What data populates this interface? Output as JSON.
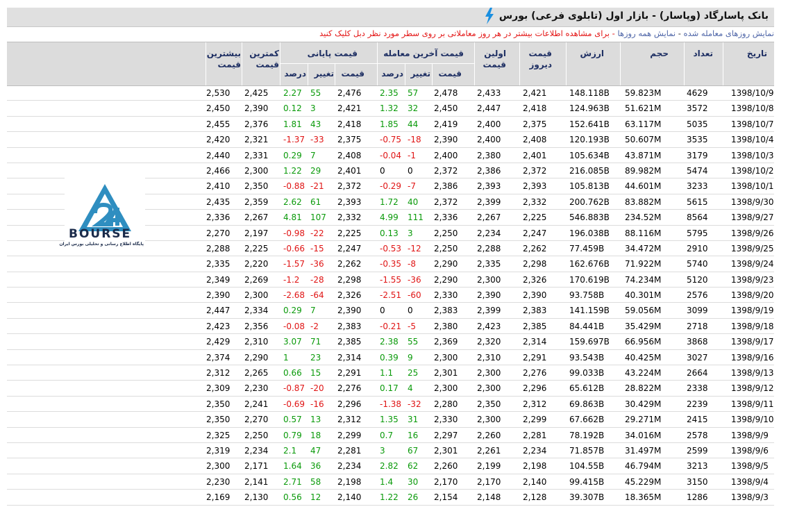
{
  "window": {
    "title": "بانک پاسارگاد (وپاسار) - بازار اول (تابلوی فرعی) بورس"
  },
  "infobar": {
    "link_traded": "نمایش روزهای معامله شده",
    "link_all": "نمایش همه روزها",
    "sep": "-",
    "message": "- برای مشاهده اطلاعات بیشتر در هر روز معاملاتی بر روی سطر مورد نظر دبل کلیک کنید"
  },
  "columns": {
    "date": "تاریخ",
    "count": "تعداد",
    "volume": "حجم",
    "value": "ارزش",
    "yesterday": "قیمت دیروز",
    "first": "اولین قیمت",
    "last_group": "قیمت آخرین معامله",
    "close_group": "قیمت پایانی",
    "price": "قیمت",
    "change": "تغییر",
    "percent": "درصد",
    "low": "کمترین قیمت",
    "high": "بیشترین قیمت"
  },
  "logo": {
    "text": "BOURSE",
    "caption": "پایگاه اطلاع رسانی و تحلیلی بورس ایران"
  },
  "rows": [
    {
      "high": "2,530",
      "low": "2,425",
      "close_pct": "2.27",
      "close_chg": "55",
      "close": "2,476",
      "last_pct": "2.35",
      "last_chg": "57",
      "last": "2,478",
      "first": "2,433",
      "yesterday": "2,421",
      "value": "148.118B",
      "volume": "59.823M",
      "count": "4629",
      "date": "1398/10/9"
    },
    {
      "high": "2,450",
      "low": "2,390",
      "close_pct": "0.12",
      "close_chg": "3",
      "close": "2,421",
      "last_pct": "1.32",
      "last_chg": "32",
      "last": "2,450",
      "first": "2,447",
      "yesterday": "2,418",
      "value": "124.963B",
      "volume": "51.621M",
      "count": "3572",
      "date": "1398/10/8"
    },
    {
      "high": "2,455",
      "low": "2,376",
      "close_pct": "1.81",
      "close_chg": "43",
      "close": "2,418",
      "last_pct": "1.85",
      "last_chg": "44",
      "last": "2,419",
      "first": "2,400",
      "yesterday": "2,375",
      "value": "152.641B",
      "volume": "63.117M",
      "count": "5035",
      "date": "1398/10/7"
    },
    {
      "high": "2,420",
      "low": "2,321",
      "close_pct": "-1.37",
      "close_chg": "-33",
      "close": "2,375",
      "last_pct": "-0.75",
      "last_chg": "-18",
      "last": "2,390",
      "first": "2,400",
      "yesterday": "2,408",
      "value": "120.193B",
      "volume": "50.607M",
      "count": "3535",
      "date": "1398/10/4"
    },
    {
      "high": "2,440",
      "low": "2,331",
      "close_pct": "0.29",
      "close_chg": "7",
      "close": "2,408",
      "last_pct": "-0.04",
      "last_chg": "-1",
      "last": "2,400",
      "first": "2,380",
      "yesterday": "2,401",
      "value": "105.634B",
      "volume": "43.871M",
      "count": "3179",
      "date": "1398/10/3"
    },
    {
      "high": "2,466",
      "low": "2,300",
      "close_pct": "1.22",
      "close_chg": "29",
      "close": "2,401",
      "last_pct": "0",
      "last_chg": "0",
      "last": "2,372",
      "first": "2,386",
      "yesterday": "2,372",
      "value": "216.085B",
      "volume": "89.982M",
      "count": "5474",
      "date": "1398/10/2"
    },
    {
      "high": "2,410",
      "low": "2,350",
      "close_pct": "-0.88",
      "close_chg": "-21",
      "close": "2,372",
      "last_pct": "-0.29",
      "last_chg": "-7",
      "last": "2,386",
      "first": "2,393",
      "yesterday": "2,393",
      "value": "105.813B",
      "volume": "44.601M",
      "count": "3233",
      "date": "1398/10/1"
    },
    {
      "high": "2,435",
      "low": "2,359",
      "close_pct": "2.62",
      "close_chg": "61",
      "close": "2,393",
      "last_pct": "1.72",
      "last_chg": "40",
      "last": "2,372",
      "first": "2,399",
      "yesterday": "2,332",
      "value": "200.762B",
      "volume": "83.882M",
      "count": "5615",
      "date": "1398/9/30"
    },
    {
      "high": "2,336",
      "low": "2,267",
      "close_pct": "4.81",
      "close_chg": "107",
      "close": "2,332",
      "last_pct": "4.99",
      "last_chg": "111",
      "last": "2,336",
      "first": "2,267",
      "yesterday": "2,225",
      "value": "546.883B",
      "volume": "234.52M",
      "count": "8564",
      "date": "1398/9/27"
    },
    {
      "high": "2,270",
      "low": "2,197",
      "close_pct": "-0.98",
      "close_chg": "-22",
      "close": "2,225",
      "last_pct": "0.13",
      "last_chg": "3",
      "last": "2,250",
      "first": "2,234",
      "yesterday": "2,247",
      "value": "196.038B",
      "volume": "88.116M",
      "count": "5795",
      "date": "1398/9/26"
    },
    {
      "high": "2,288",
      "low": "2,225",
      "close_pct": "-0.66",
      "close_chg": "-15",
      "close": "2,247",
      "last_pct": "-0.53",
      "last_chg": "-12",
      "last": "2,250",
      "first": "2,288",
      "yesterday": "2,262",
      "value": "77.459B",
      "volume": "34.472M",
      "count": "2910",
      "date": "1398/9/25"
    },
    {
      "high": "2,335",
      "low": "2,220",
      "close_pct": "-1.57",
      "close_chg": "-36",
      "close": "2,262",
      "last_pct": "-0.35",
      "last_chg": "-8",
      "last": "2,290",
      "first": "2,335",
      "yesterday": "2,298",
      "value": "162.676B",
      "volume": "71.922M",
      "count": "5740",
      "date": "1398/9/24"
    },
    {
      "high": "2,349",
      "low": "2,269",
      "close_pct": "-1.2",
      "close_chg": "-28",
      "close": "2,298",
      "last_pct": "-1.55",
      "last_chg": "-36",
      "last": "2,290",
      "first": "2,300",
      "yesterday": "2,326",
      "value": "170.619B",
      "volume": "74.234M",
      "count": "5120",
      "date": "1398/9/23"
    },
    {
      "high": "2,390",
      "low": "2,300",
      "close_pct": "-2.68",
      "close_chg": "-64",
      "close": "2,326",
      "last_pct": "-2.51",
      "last_chg": "-60",
      "last": "2,330",
      "first": "2,390",
      "yesterday": "2,390",
      "value": "93.758B",
      "volume": "40.301M",
      "count": "2576",
      "date": "1398/9/20"
    },
    {
      "high": "2,447",
      "low": "2,334",
      "close_pct": "0.29",
      "close_chg": "7",
      "close": "2,390",
      "last_pct": "0",
      "last_chg": "0",
      "last": "2,383",
      "first": "2,399",
      "yesterday": "2,383",
      "value": "141.159B",
      "volume": "59.056M",
      "count": "3099",
      "date": "1398/9/19"
    },
    {
      "high": "2,423",
      "low": "2,356",
      "close_pct": "-0.08",
      "close_chg": "-2",
      "close": "2,383",
      "last_pct": "-0.21",
      "last_chg": "-5",
      "last": "2,380",
      "first": "2,423",
      "yesterday": "2,385",
      "value": "84.441B",
      "volume": "35.429M",
      "count": "2718",
      "date": "1398/9/18"
    },
    {
      "high": "2,429",
      "low": "2,310",
      "close_pct": "3.07",
      "close_chg": "71",
      "close": "2,385",
      "last_pct": "2.38",
      "last_chg": "55",
      "last": "2,369",
      "first": "2,320",
      "yesterday": "2,314",
      "value": "159.697B",
      "volume": "66.956M",
      "count": "3868",
      "date": "1398/9/17"
    },
    {
      "high": "2,374",
      "low": "2,290",
      "close_pct": "1",
      "close_chg": "23",
      "close": "2,314",
      "last_pct": "0.39",
      "last_chg": "9",
      "last": "2,300",
      "first": "2,310",
      "yesterday": "2,291",
      "value": "93.543B",
      "volume": "40.425M",
      "count": "3027",
      "date": "1398/9/16"
    },
    {
      "high": "2,312",
      "low": "2,265",
      "close_pct": "0.66",
      "close_chg": "15",
      "close": "2,291",
      "last_pct": "1.1",
      "last_chg": "25",
      "last": "2,301",
      "first": "2,300",
      "yesterday": "2,276",
      "value": "99.033B",
      "volume": "43.224M",
      "count": "2664",
      "date": "1398/9/13"
    },
    {
      "high": "2,309",
      "low": "2,230",
      "close_pct": "-0.87",
      "close_chg": "-20",
      "close": "2,276",
      "last_pct": "0.17",
      "last_chg": "4",
      "last": "2,300",
      "first": "2,300",
      "yesterday": "2,296",
      "value": "65.612B",
      "volume": "28.822M",
      "count": "2338",
      "date": "1398/9/12"
    },
    {
      "high": "2,350",
      "low": "2,241",
      "close_pct": "-0.69",
      "close_chg": "-16",
      "close": "2,296",
      "last_pct": "-1.38",
      "last_chg": "-32",
      "last": "2,280",
      "first": "2,350",
      "yesterday": "2,312",
      "value": "69.863B",
      "volume": "30.429M",
      "count": "2239",
      "date": "1398/9/11"
    },
    {
      "high": "2,350",
      "low": "2,270",
      "close_pct": "0.57",
      "close_chg": "13",
      "close": "2,312",
      "last_pct": "1.35",
      "last_chg": "31",
      "last": "2,330",
      "first": "2,300",
      "yesterday": "2,299",
      "value": "67.662B",
      "volume": "29.271M",
      "count": "2415",
      "date": "1398/9/10"
    },
    {
      "high": "2,325",
      "low": "2,250",
      "close_pct": "0.79",
      "close_chg": "18",
      "close": "2,299",
      "last_pct": "0.7",
      "last_chg": "16",
      "last": "2,297",
      "first": "2,260",
      "yesterday": "2,281",
      "value": "78.192B",
      "volume": "34.016M",
      "count": "2578",
      "date": "1398/9/9"
    },
    {
      "high": "2,319",
      "low": "2,234",
      "close_pct": "2.1",
      "close_chg": "47",
      "close": "2,281",
      "last_pct": "3",
      "last_chg": "67",
      "last": "2,301",
      "first": "2,261",
      "yesterday": "2,234",
      "value": "71.857B",
      "volume": "31.497M",
      "count": "2599",
      "date": "1398/9/6"
    },
    {
      "high": "2,300",
      "low": "2,171",
      "close_pct": "1.64",
      "close_chg": "36",
      "close": "2,234",
      "last_pct": "2.82",
      "last_chg": "62",
      "last": "2,260",
      "first": "2,199",
      "yesterday": "2,198",
      "value": "104.55B",
      "volume": "46.794M",
      "count": "3213",
      "date": "1398/9/5"
    },
    {
      "high": "2,230",
      "low": "2,141",
      "close_pct": "2.71",
      "close_chg": "58",
      "close": "2,198",
      "last_pct": "1.4",
      "last_chg": "30",
      "last": "2,170",
      "first": "2,170",
      "yesterday": "2,140",
      "value": "99.415B",
      "volume": "45.229M",
      "count": "3150",
      "date": "1398/9/4"
    },
    {
      "high": "2,169",
      "low": "2,130",
      "close_pct": "0.56",
      "close_chg": "12",
      "close": "2,140",
      "last_pct": "1.22",
      "last_chg": "26",
      "last": "2,154",
      "first": "2,148",
      "yesterday": "2,128",
      "value": "39.307B",
      "volume": "18.365M",
      "count": "1286",
      "date": "1398/9/3"
    }
  ]
}
